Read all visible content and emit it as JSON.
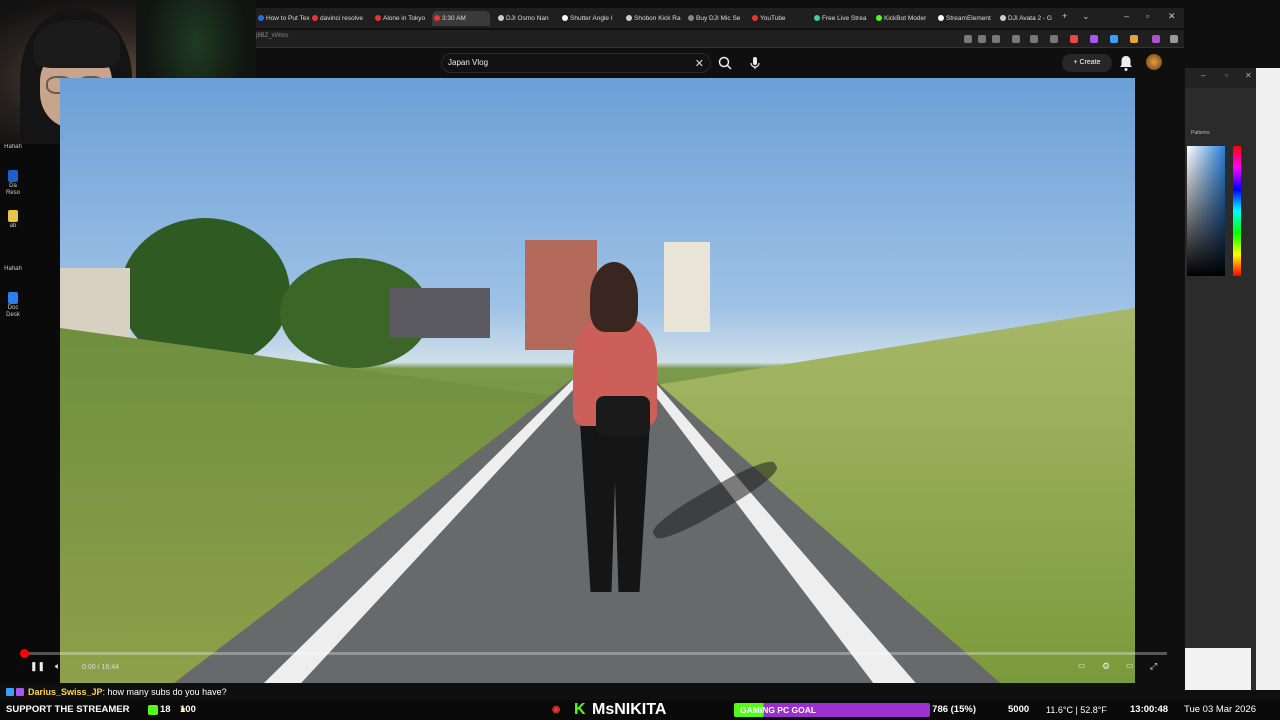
{
  "browser": {
    "tabs": [
      {
        "label": "How to Put Tex"
      },
      {
        "label": "davinci resolve"
      },
      {
        "label": "Alone in Tokyo"
      },
      {
        "label": "3:30 AM"
      },
      {
        "label": "DJI Osmo Nan"
      },
      {
        "label": "Shutter Angle I"
      },
      {
        "label": "Shobon Kick Ra"
      },
      {
        "label": "Buy DJI Mic Se"
      },
      {
        "label": "YouTube"
      },
      {
        "label": "Free Live Strea"
      },
      {
        "label": "KickBot Moder"
      },
      {
        "label": "StreamElement"
      },
      {
        "label": "DJI Avata 2 - G"
      }
    ],
    "url": "j8BZ_xWms"
  },
  "youtube": {
    "search_query": "Japan Vlog",
    "create_label": "Create"
  },
  "player": {
    "time": "0:00 / 16:44",
    "progress_fraction": 0.0
  },
  "ps_panel": {
    "tab_label": "Patterns"
  },
  "chat": {
    "user": "Darius_Swiss_JP",
    "message": ": how many subs do you have?"
  },
  "bottom_bar": {
    "support": "SUPPORT THE STREAMER",
    "kick_count": "18",
    "points": "100",
    "channel": "MsNIKITA",
    "goal_label": "GAMING PC GOAL",
    "goal_progress": "786 (15%)",
    "goal_target": "5000",
    "weather": "11.6°C | 52.8°F",
    "clock": "13:00:48",
    "date": "Tue 03 Mar 2026"
  },
  "desktop": {
    "labels": [
      "Hahah",
      "Da Reso",
      "ab",
      "Hahah",
      "Doc Desk"
    ]
  }
}
